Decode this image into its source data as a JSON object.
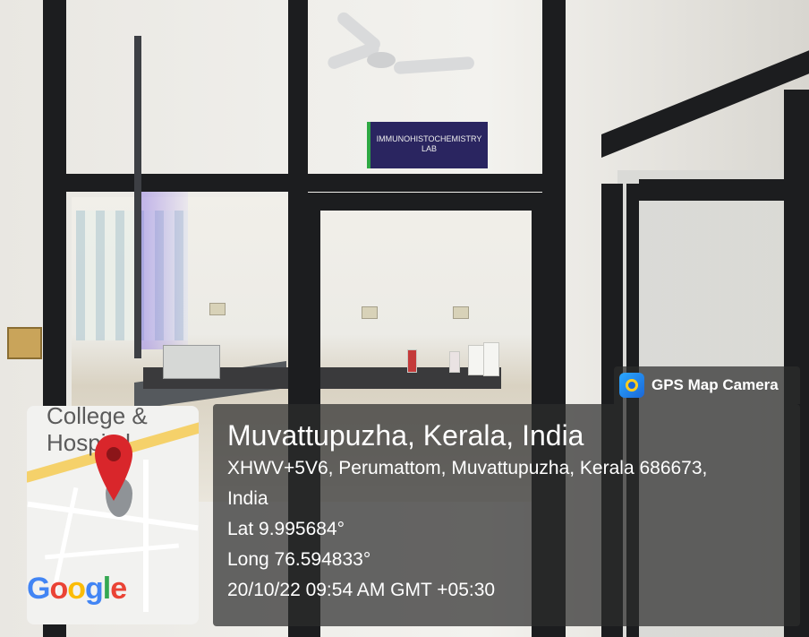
{
  "scene": {
    "sign_text": "IMMUNOHISTOCHEMISTRY LAB"
  },
  "overlay": {
    "app_name": "GPS Map Camera",
    "map_label": "College & Hospital",
    "map_logo": "Google",
    "location_title": "Muvattupuzha, Kerala, India",
    "address_line1": "XHWV+5V6, Perumattom, Muvattupuzha, Kerala 686673,",
    "address_line2": "India",
    "latitude": "Lat 9.995684°",
    "longitude": "Long 76.594833°",
    "timestamp": "20/10/22 09:54 AM GMT +05:30"
  },
  "colors": {
    "pin": "#d9262b",
    "sign_bg": "#2a2560",
    "frame": "#1c1d1f"
  },
  "icons": [
    "gps-map-camera-icon",
    "map-pin-icon"
  ]
}
